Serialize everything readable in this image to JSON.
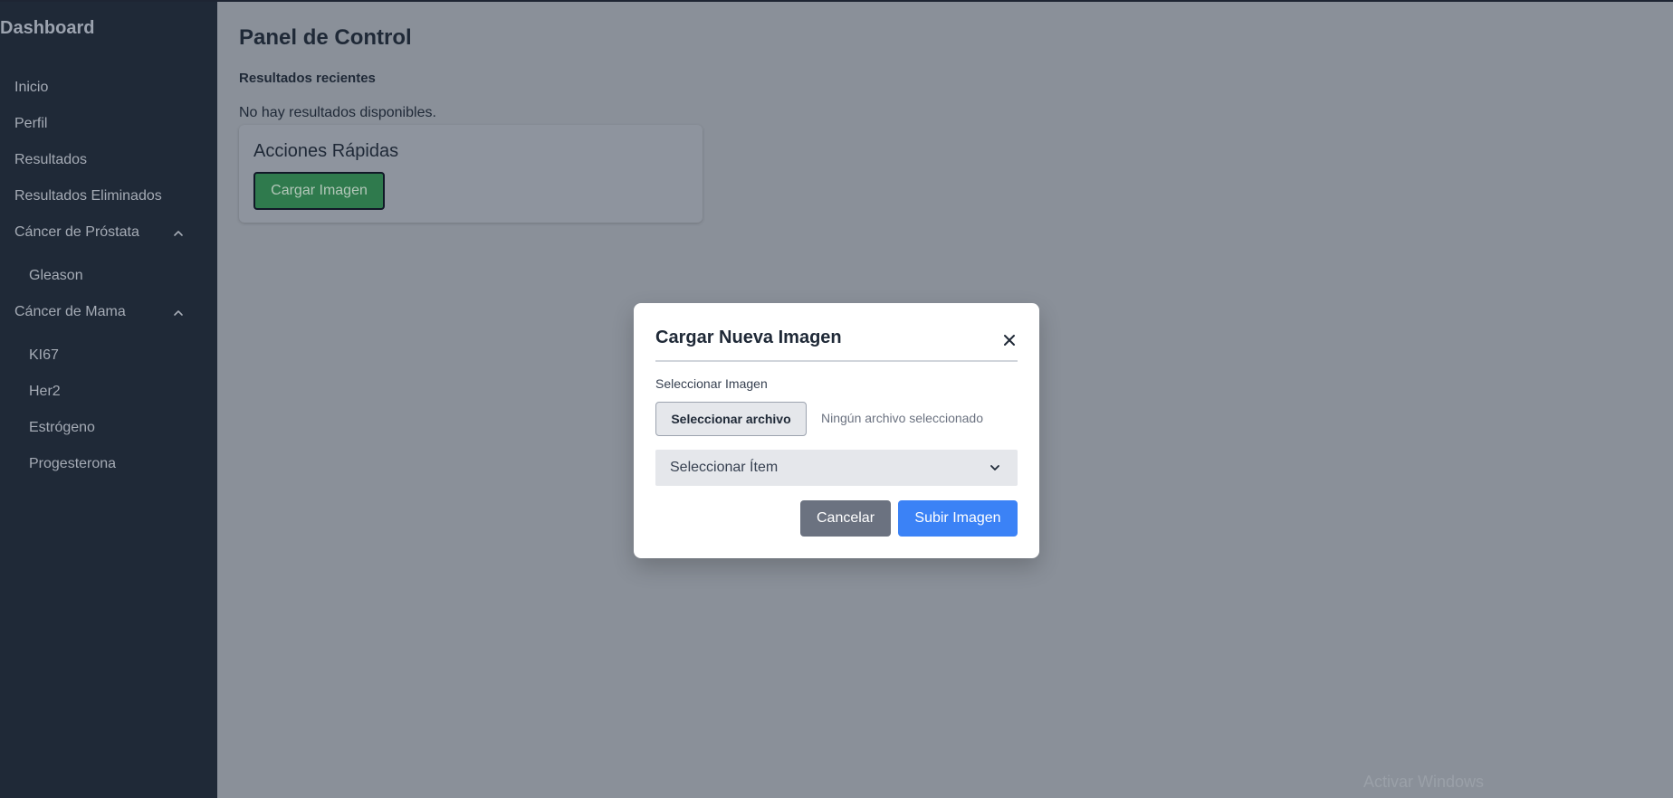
{
  "sidebar": {
    "title": "Dashboard",
    "items": [
      {
        "label": "Inicio"
      },
      {
        "label": "Perfil"
      },
      {
        "label": "Resultados"
      },
      {
        "label": "Resultados Eliminados"
      },
      {
        "label": "Cáncer de Próstata",
        "expanded": true,
        "icon": "chevron-up-icon",
        "children": [
          {
            "label": "Gleason"
          }
        ]
      },
      {
        "label": "Cáncer de Mama",
        "expanded": true,
        "icon": "chevron-up-icon",
        "children": [
          {
            "label": "KI67"
          },
          {
            "label": "Her2"
          },
          {
            "label": "Estrógeno"
          },
          {
            "label": "Progesterona"
          }
        ]
      }
    ]
  },
  "main": {
    "title": "Panel de Control",
    "recent_label": "Resultados recientes",
    "empty_message": "No hay resultados disponibles.",
    "quick_actions": {
      "title": "Acciones Rápidas",
      "button_label": "Cargar Imagen",
      "button_color": "#2f7a4d"
    }
  },
  "modal": {
    "title": "Cargar Nueva Imagen",
    "close_icon": "close-icon",
    "field_label": "Seleccionar Imagen",
    "file_button_label": "Seleccionar archivo",
    "file_status": "Ningún archivo seleccionado",
    "select_value": "Seleccionar Ítem",
    "select_icon": "chevron-down-icon",
    "cancel_label": "Cancelar",
    "upload_label": "Subir Imagen",
    "cancel_color": "#6b7280",
    "upload_color": "#3b82f6"
  },
  "watermark": "Activar Windows",
  "colors": {
    "sidebar_bg": "#1f2937",
    "overlay_bg": "#8a9099"
  }
}
